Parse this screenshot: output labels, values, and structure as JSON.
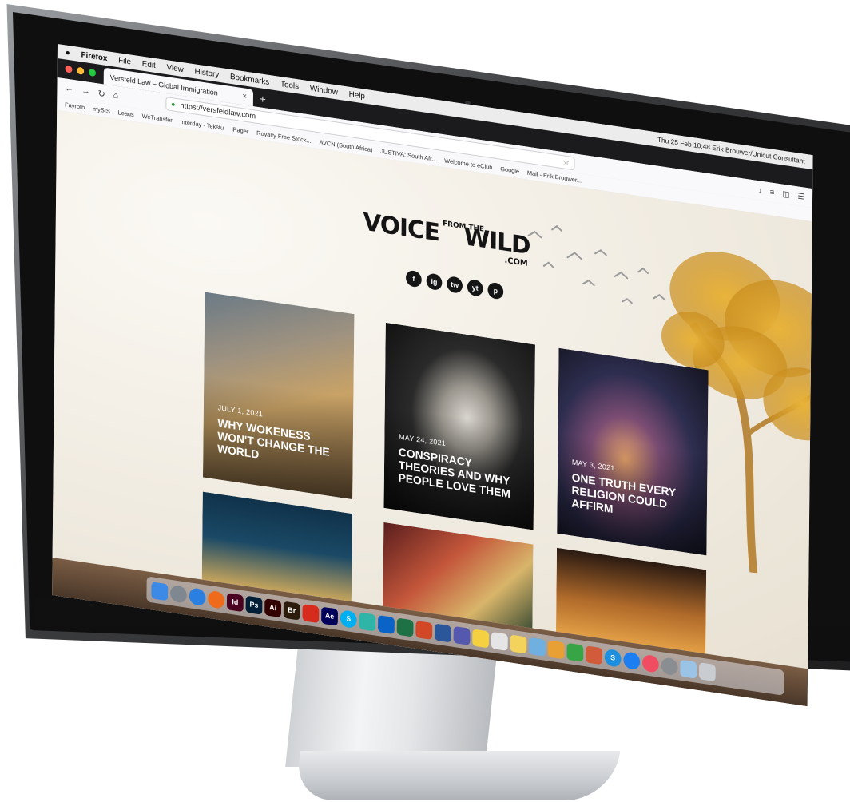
{
  "menubar": {
    "app_name": "Firefox",
    "items": [
      "File",
      "Edit",
      "View",
      "History",
      "Bookmarks",
      "Tools",
      "Window",
      "Help"
    ],
    "status_text": "Thu 25 Feb 10:48   Erik Brouwer/Unicut Consultant"
  },
  "browser": {
    "tab_title": "Versfeld Law – Global Immigration",
    "url": "https://versfeldlaw.com",
    "bookmarks": [
      "Fayroth",
      "mySIS",
      "Leaus",
      "WeTransfer",
      "Interday - Tekstu",
      "iPager",
      "Royalty Free Stock...",
      "AVCN (South Africa)",
      "JUSTIVA: South Afr...",
      "Welcome to eClub",
      "Google",
      "Mail - Erik Brouwer..."
    ]
  },
  "site": {
    "logo": {
      "word1": "VOICE",
      "small": "FROM THE",
      "word2": "WILD",
      "suffix": ".COM"
    },
    "social": [
      "f",
      "ig",
      "tw",
      "yt",
      "p"
    ],
    "cards": [
      {
        "date": "JULY 1, 2021",
        "title": "WHY WOKENESS WON'T CHANGE THE WORLD"
      },
      {
        "date": "MAY 24, 2021",
        "title": "CONSPIRACY THEORIES AND WHY PEOPLE LOVE THEM"
      },
      {
        "date": "MAY 3, 2021",
        "title": "ONE TRUTH EVERY RELIGION COULD AFFIRM"
      }
    ]
  },
  "dock": {
    "apps": [
      {
        "name": "finder-icon",
        "label": "",
        "color": "#3d8ae6"
      },
      {
        "name": "launchpad-icon",
        "label": "",
        "color": "#7f8791"
      },
      {
        "name": "safari-icon",
        "label": "",
        "color": "#2a7fe0"
      },
      {
        "name": "firefox-icon",
        "label": "",
        "color": "#ef6a1a"
      },
      {
        "name": "indesign-icon",
        "label": "Id",
        "color": "#49021f"
      },
      {
        "name": "photoshop-icon",
        "label": "Ps",
        "color": "#001e36"
      },
      {
        "name": "illustrator-icon",
        "label": "Ai",
        "color": "#330000"
      },
      {
        "name": "bridge-icon",
        "label": "Br",
        "color": "#2b1b0b"
      },
      {
        "name": "acrobat-icon",
        "label": "",
        "color": "#d72b1e"
      },
      {
        "name": "after-effects-icon",
        "label": "Ae",
        "color": "#00005b"
      },
      {
        "name": "skype-icon",
        "label": "S",
        "color": "#00aff0"
      },
      {
        "name": "app-icon",
        "label": "",
        "color": "#2fb5a8"
      },
      {
        "name": "outlook-icon",
        "label": "",
        "color": "#0a64c8"
      },
      {
        "name": "excel-icon",
        "label": "",
        "color": "#1e7145"
      },
      {
        "name": "powerpoint-icon",
        "label": "",
        "color": "#d24726"
      },
      {
        "name": "word-icon",
        "label": "",
        "color": "#2b579a"
      },
      {
        "name": "teams-icon",
        "label": "",
        "color": "#5558af"
      },
      {
        "name": "notes-icon",
        "label": "",
        "color": "#f5d142"
      },
      {
        "name": "textedit-icon",
        "label": "",
        "color": "#e5e5e5"
      },
      {
        "name": "stickies-icon",
        "label": "",
        "color": "#f3d35b"
      },
      {
        "name": "preview-icon",
        "label": "",
        "color": "#6fb0e0"
      },
      {
        "name": "photos-icon",
        "label": "",
        "color": "#e8a035"
      },
      {
        "name": "numbers-icon",
        "label": "",
        "color": "#37a546"
      },
      {
        "name": "app-icon",
        "label": "",
        "color": "#d15b3a"
      },
      {
        "name": "skype-icon",
        "label": "S",
        "color": "#1d8fe0"
      },
      {
        "name": "app-store-icon",
        "label": "",
        "color": "#1c7ef0"
      },
      {
        "name": "music-icon",
        "label": "",
        "color": "#f04c62"
      },
      {
        "name": "system-preferences-icon",
        "label": "",
        "color": "#8a8d92"
      },
      {
        "name": "folder-icon",
        "label": "",
        "color": "#9bc3e6"
      },
      {
        "name": "trash-icon",
        "label": "",
        "color": "#c9cdd2"
      }
    ]
  }
}
